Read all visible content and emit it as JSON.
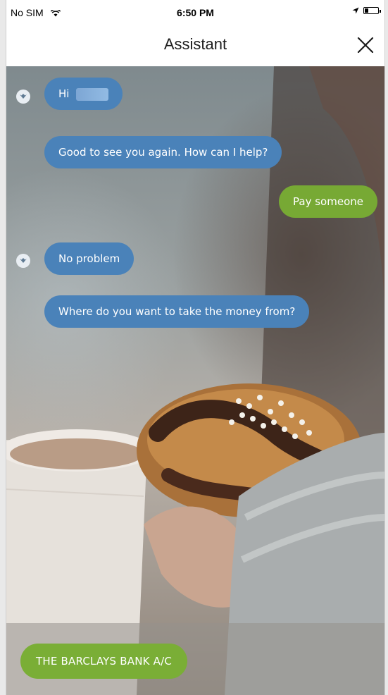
{
  "status_bar": {
    "carrier": "No SIM",
    "time": "6:50 PM",
    "battery_level": 0.25
  },
  "nav": {
    "title": "Assistant",
    "close_icon": "close-icon"
  },
  "chat": {
    "messages": [
      {
        "sender": "bot",
        "text": "Hi",
        "redacted_name": true
      },
      {
        "sender": "bot",
        "text": "Good to see you again. How can I help?"
      },
      {
        "sender": "user",
        "text": "Pay someone"
      },
      {
        "sender": "bot",
        "text": "No problem"
      },
      {
        "sender": "bot",
        "text": "Where do you want to take the money from?"
      }
    ]
  },
  "quick_reply": {
    "label": "THE BARCLAYS BANK A/C"
  },
  "colors": {
    "bot_bubble": "#4a82b9",
    "user_bubble": "#77a934",
    "quick_reply": "#7aae36"
  }
}
